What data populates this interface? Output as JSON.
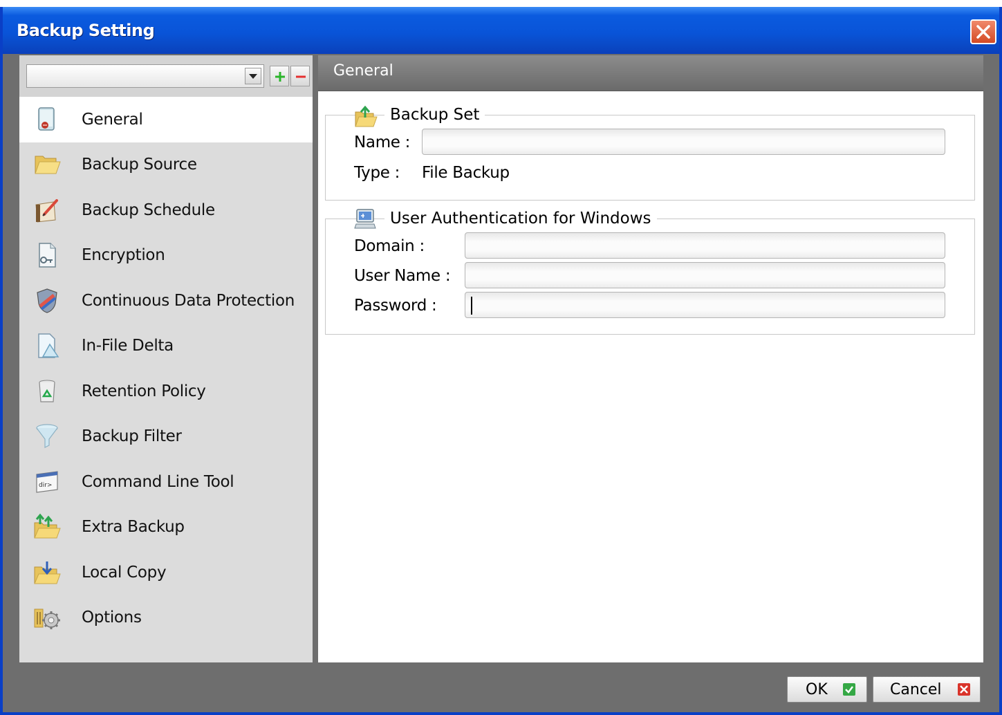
{
  "window": {
    "title": "Backup Setting"
  },
  "left": {
    "backup_set_select": {
      "value": ""
    },
    "nav": [
      {
        "label": "General",
        "icon": "general-icon",
        "selected": true
      },
      {
        "label": "Backup Source",
        "icon": "folder-icon"
      },
      {
        "label": "Backup Schedule",
        "icon": "schedule-icon"
      },
      {
        "label": "Encryption",
        "icon": "encryption-key-icon"
      },
      {
        "label": "Continuous Data Protection",
        "icon": "shield-icon"
      },
      {
        "label": "In-File Delta",
        "icon": "delta-icon"
      },
      {
        "label": "Retention Policy",
        "icon": "recycle-bin-icon"
      },
      {
        "label": "Backup Filter",
        "icon": "funnel-icon"
      },
      {
        "label": "Command Line Tool",
        "icon": "command-line-icon"
      },
      {
        "label": "Extra Backup",
        "icon": "extra-backup-icon"
      },
      {
        "label": "Local Copy",
        "icon": "local-copy-icon"
      },
      {
        "label": "Options",
        "icon": "options-gear-icon"
      }
    ]
  },
  "right": {
    "header": "General",
    "backup_set": {
      "title": "Backup Set",
      "name_label": "Name :",
      "name_value": "",
      "type_label": "Type :",
      "type_value": "File Backup"
    },
    "user_auth": {
      "title": "User Authentication for Windows",
      "domain_label": "Domain :",
      "domain_value": "",
      "username_label": "User Name :",
      "username_value": "",
      "password_label": "Password :",
      "password_value": ""
    }
  },
  "footer": {
    "ok_label": "OK",
    "cancel_label": "Cancel"
  },
  "colors": {
    "titlebar": "#0954d8",
    "panel_bg": "#6e6e6e",
    "selected_item": "#ffffff"
  }
}
